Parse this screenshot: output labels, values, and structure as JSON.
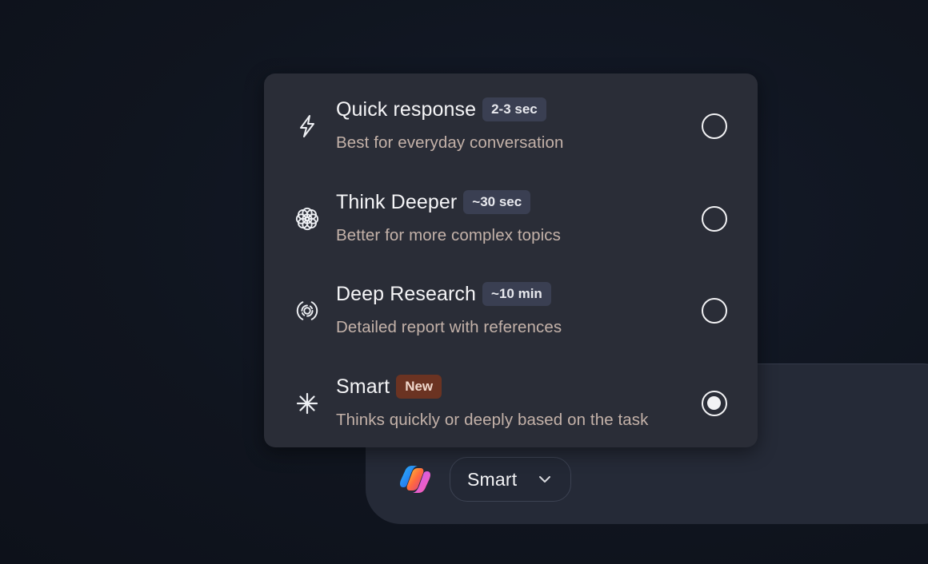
{
  "menu": {
    "items": [
      {
        "icon": "lightning-icon",
        "title": "Quick response",
        "badge": "2-3 sec",
        "badge_style": "neutral",
        "description": "Best for everyday conversation",
        "selected": false
      },
      {
        "icon": "flower-icon",
        "title": "Think Deeper",
        "badge": "~30 sec",
        "badge_style": "neutral",
        "description": "Better for more complex topics",
        "selected": false
      },
      {
        "icon": "concentric-target-icon",
        "title": "Deep Research",
        "badge": "~10 min",
        "badge_style": "neutral",
        "description": "Detailed report with references",
        "selected": false
      },
      {
        "icon": "sparkle-asterisk-icon",
        "title": "Smart",
        "badge": "New",
        "badge_style": "highlight",
        "description": "Thinks quickly or deeply based on the task",
        "selected": true
      }
    ]
  },
  "composer": {
    "logo": "copilot-logo-icon",
    "mode_select": {
      "value": "Smart",
      "icon": "chevron-down-icon"
    }
  },
  "colors": {
    "background": "#10151f",
    "menu_background": "#2a2d37",
    "composer_background": "#252a37",
    "badge_neutral": "#3a3f52",
    "badge_new": "#6b3322",
    "description_text": "#c4b2a9"
  }
}
